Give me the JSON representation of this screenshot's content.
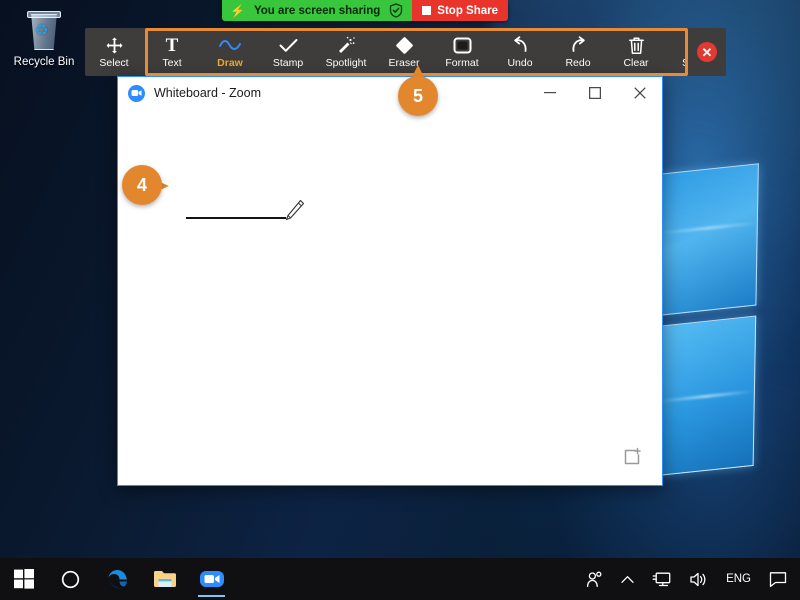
{
  "desktop": {
    "recycle_bin": {
      "label": "Recycle Bin",
      "icon": "recycle-bin-icon",
      "symbol": "♻"
    }
  },
  "share_banner": {
    "bolt_icon": "lightning-bolt-icon",
    "bolt_glyph": "⚡",
    "message": "You are screen sharing",
    "shield_icon": "shield-check-icon",
    "stop_button": {
      "label": "Stop Share",
      "icon": "stop-square-icon",
      "color": "#e8342a"
    },
    "background_color": "#37c63c"
  },
  "annotation_toolbar": {
    "background_color": "#3f3d3b",
    "highlight_color": "#e98a35",
    "active_label_color": "#f5a623",
    "active_icon_color": "#2d8cff",
    "tools": [
      {
        "label": "Select",
        "icon": "move-arrows-icon",
        "active": false,
        "highlighted": false
      },
      {
        "label": "Text",
        "icon": "text-t-icon",
        "active": false,
        "highlighted": true
      },
      {
        "label": "Draw",
        "icon": "squiggle-draw-icon",
        "active": true,
        "highlighted": true
      },
      {
        "label": "Stamp",
        "icon": "checkmark-stamp-icon",
        "active": false,
        "highlighted": true
      },
      {
        "label": "Spotlight",
        "icon": "spotlight-wand-icon",
        "active": false,
        "highlighted": true
      },
      {
        "label": "Eraser",
        "icon": "eraser-icon",
        "active": false,
        "highlighted": true
      },
      {
        "label": "Format",
        "icon": "format-swatch-icon",
        "active": false,
        "highlighted": true
      },
      {
        "label": "Undo",
        "icon": "undo-arrow-icon",
        "active": false,
        "highlighted": true
      },
      {
        "label": "Redo",
        "icon": "redo-arrow-icon",
        "active": false,
        "highlighted": true
      },
      {
        "label": "Clear",
        "icon": "trash-clear-icon",
        "active": false,
        "highlighted": true
      },
      {
        "label": "Save",
        "icon": "save-download-icon",
        "active": false,
        "highlighted": true
      }
    ],
    "close_button": {
      "icon": "close-circle-icon",
      "glyph": "✕",
      "color": "#e03a33"
    }
  },
  "whiteboard_window": {
    "title": "Whiteboard - Zoom",
    "app_icon": "zoom-camera-icon",
    "window_controls": [
      {
        "name": "minimize",
        "icon": "minimize-icon"
      },
      {
        "name": "maximize",
        "icon": "maximize-icon"
      },
      {
        "name": "close",
        "icon": "close-icon"
      }
    ],
    "canvas": {
      "drawn_stroke": "black-horizontal-line",
      "cursor_icon": "pencil-cursor-icon",
      "add_page_icon": "add-page-icon"
    }
  },
  "callouts": [
    {
      "number": "4",
      "direction": "right",
      "target": "drawn-line-on-canvas"
    },
    {
      "number": "5",
      "direction": "up",
      "target": "eraser-tool"
    }
  ],
  "taskbar": {
    "background_color": "#101012",
    "items": [
      {
        "name": "start",
        "icon": "windows-start-icon"
      },
      {
        "name": "cortana",
        "icon": "cortana-circle-icon"
      },
      {
        "name": "edge",
        "icon": "edge-browser-icon"
      },
      {
        "name": "file-explorer",
        "icon": "folder-icon"
      },
      {
        "name": "zoom",
        "icon": "zoom-camera-icon",
        "active": true
      }
    ],
    "tray": [
      {
        "name": "people",
        "icon": "people-icon"
      },
      {
        "name": "show-hidden",
        "icon": "chevron-up-icon"
      },
      {
        "name": "network",
        "icon": "monitor-network-icon"
      },
      {
        "name": "volume",
        "icon": "speaker-volume-icon"
      },
      {
        "name": "language",
        "icon": "language-indicator",
        "label": "ENG"
      },
      {
        "name": "action-center",
        "icon": "speech-bubble-icon"
      }
    ]
  }
}
